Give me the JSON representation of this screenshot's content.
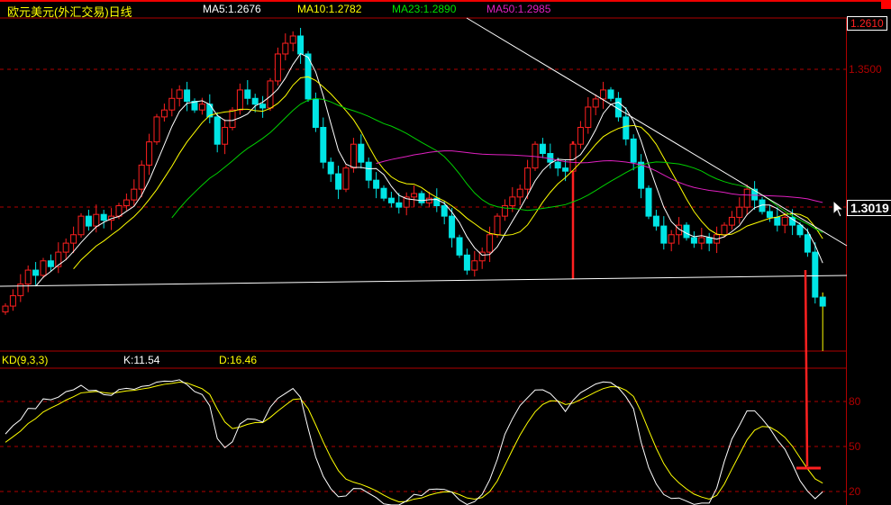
{
  "header": {
    "title": "欧元美元(外汇交易)日线",
    "ma5": "MA5:1.2676",
    "ma10": "MA10:1.2782",
    "ma23": "MA23:1.2890",
    "ma50": "MA50:1.2985"
  },
  "kd_header": {
    "name": "KD(9,3,3)",
    "k": "K:11.54",
    "d": "D:16.46"
  },
  "price_axis": {
    "top_box": "1.2610",
    "level": "1.3500",
    "current_box": "1.3019"
  },
  "kd_axis": {
    "labels": [
      "80",
      "50",
      "20"
    ]
  },
  "colors": {
    "up": "#ff2020",
    "down": "#00e5e5",
    "ma5": "#ffffff",
    "ma10": "#ffff00",
    "ma23": "#00d000",
    "ma50": "#e020c0",
    "grid": "#b00000",
    "k": "#ffffff",
    "d": "#ffff00"
  },
  "chart_data": {
    "type": "candlestick",
    "title": "欧元美元(外汇交易)日线",
    "ylim": [
      1.2529,
      1.3677
    ],
    "kd_ylim": [
      0,
      100
    ],
    "ma_periods": [
      5,
      10,
      23,
      50
    ],
    "closes": [
      1.2684,
      1.272,
      1.276,
      1.2808,
      1.279,
      1.284,
      1.282,
      1.287,
      1.2901,
      1.293,
      1.2994,
      1.296,
      1.3,
      1.298,
      1.2994,
      1.303,
      1.305,
      1.3087,
      1.317,
      1.325,
      1.3336,
      1.336,
      1.34,
      1.3429,
      1.339,
      1.336,
      1.338,
      1.3336,
      1.3242,
      1.33,
      1.336,
      1.3429,
      1.34,
      1.338,
      1.3367,
      1.346,
      1.3553,
      1.359,
      1.3615,
      1.3553,
      1.3398,
      1.33,
      1.318,
      1.314,
      1.3087,
      1.316,
      1.3242,
      1.318,
      1.3118,
      1.309,
      1.3056,
      1.304,
      1.3025,
      1.306,
      1.3072,
      1.304,
      1.3056,
      1.303,
      1.2994,
      1.292,
      1.286,
      1.2808,
      1.284,
      1.287,
      1.293,
      1.2994,
      1.303,
      1.306,
      1.3087,
      1.316,
      1.3242,
      1.321,
      1.318,
      1.316,
      1.3149,
      1.3242,
      1.33,
      1.337,
      1.3398,
      1.3429,
      1.34,
      1.3336,
      1.326,
      1.318,
      1.309,
      1.2994,
      1.296,
      1.2901,
      1.293,
      1.2963,
      1.292,
      1.2901,
      1.292,
      1.2901,
      1.293,
      1.2963,
      1.299,
      1.3025,
      1.3087,
      1.305,
      1.301,
      1.299,
      1.2963,
      1.299,
      1.2963,
      1.293,
      1.287,
      1.2715,
      1.2684
    ],
    "spike_lows": [
      {
        "index": 75,
        "low": 1.2777
      },
      {
        "index": 108,
        "low": 1.2529
      }
    ],
    "last_k": 11.54,
    "last_d": 16.46
  }
}
